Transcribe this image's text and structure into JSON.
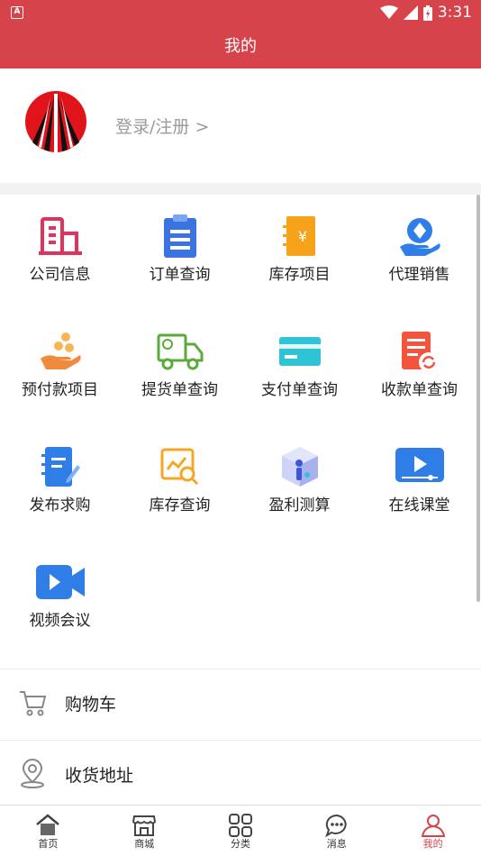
{
  "status_bar": {
    "time": "3:31",
    "notification_glyph": "A"
  },
  "header": {
    "title": "我的"
  },
  "login": {
    "label": "登录/注册 >"
  },
  "grid": [
    {
      "label": "公司信息",
      "icon": "building-icon"
    },
    {
      "label": "订单查询",
      "icon": "clipboard-icon"
    },
    {
      "label": "库存项目",
      "icon": "inventory-book-icon"
    },
    {
      "label": "代理销售",
      "icon": "agent-hand-icon"
    },
    {
      "label": "预付款项目",
      "icon": "prepay-coins-hand-icon"
    },
    {
      "label": "提货单查询",
      "icon": "delivery-truck-icon"
    },
    {
      "label": "支付单查询",
      "icon": "payment-card-icon"
    },
    {
      "label": "收款单查询",
      "icon": "receipt-refresh-icon"
    },
    {
      "label": "发布求购",
      "icon": "notebook-pen-icon"
    },
    {
      "label": "库存查询",
      "icon": "stock-search-icon"
    },
    {
      "label": "盈利测算",
      "icon": "profit-cube-icon"
    },
    {
      "label": "在线课堂",
      "icon": "video-play-icon"
    },
    {
      "label": "视频会议",
      "icon": "video-camera-icon"
    }
  ],
  "list": [
    {
      "label": "购物车",
      "icon": "cart-icon"
    },
    {
      "label": "收货地址",
      "icon": "location-pin-icon"
    }
  ],
  "tabs": [
    {
      "label": "首页",
      "icon": "home-icon"
    },
    {
      "label": "商城",
      "icon": "shop-icon"
    },
    {
      "label": "分类",
      "icon": "category-grid-icon"
    },
    {
      "label": "消息",
      "icon": "message-bubble-icon"
    },
    {
      "label": "我的",
      "icon": "profile-icon",
      "active": true
    }
  ],
  "colors": {
    "brand": "#d7434b",
    "tab_active": "#d7434b",
    "muted_text": "#9a9a9a"
  }
}
